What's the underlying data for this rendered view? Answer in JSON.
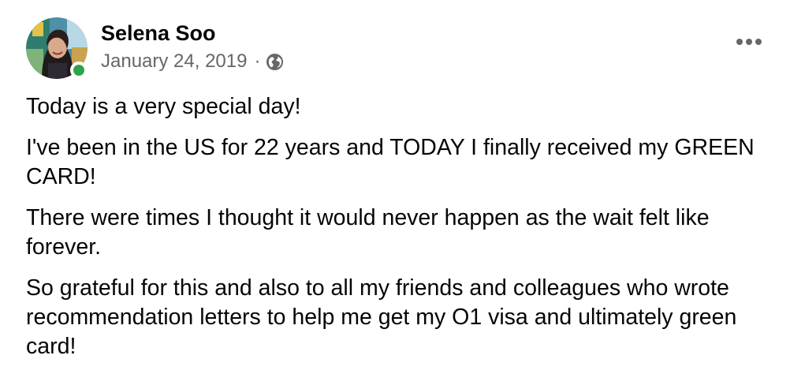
{
  "post": {
    "author": {
      "name": "Selena Soo",
      "online": true,
      "avatar_icon": "profile-photo"
    },
    "meta": {
      "date": "January 24, 2019",
      "separator": "·",
      "privacy_icon": "globe-icon"
    },
    "menu_icon": "more-horizontal-icon",
    "paragraphs": [
      "Today is a very special day!",
      "I've been in the US for 22 years and TODAY I finally received my GREEN CARD!",
      "There were times I thought it would never happen as the wait felt like forever.",
      "So grateful for this and also to all my friends and colleagues who wrote recommendation letters to help me get my O1 visa and ultimately green card!"
    ]
  },
  "colors": {
    "text_primary": "#050505",
    "text_secondary": "#65676b",
    "online_green": "#31a24c",
    "background": "#ffffff"
  }
}
